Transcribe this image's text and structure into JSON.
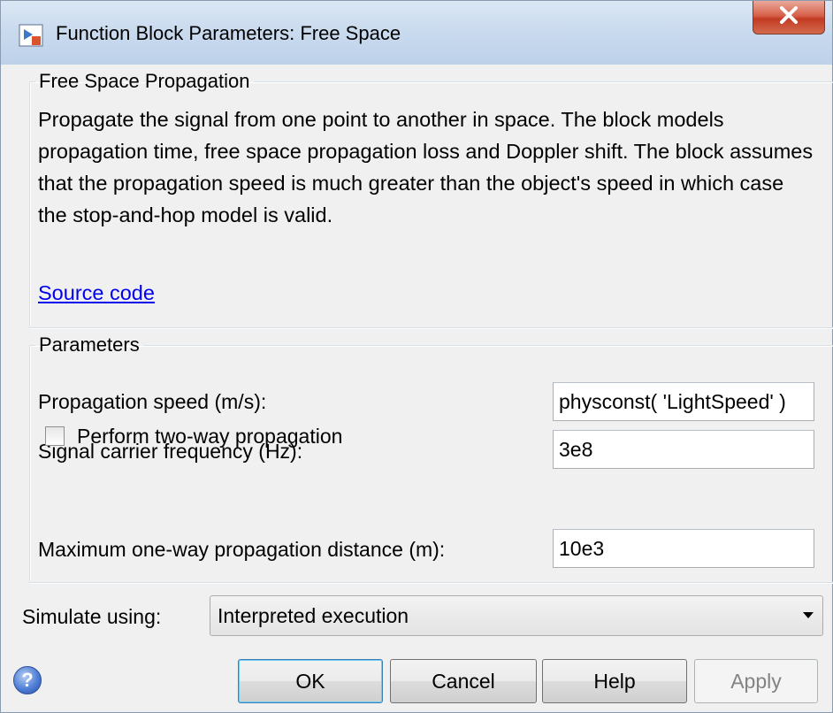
{
  "window": {
    "title": "Function Block Parameters: Free Space",
    "close_glyph": "X"
  },
  "description_group": {
    "legend": "Free Space Propagation",
    "text": "Propagate the signal from one point to another in space. The block models propagation time, free space propagation loss and Doppler shift. The block assumes that the propagation speed is much greater than the object's speed in which case the stop-and-hop model is valid.",
    "link": "Source code"
  },
  "parameters_group": {
    "legend": "Parameters",
    "propagation_speed": {
      "label": "Propagation speed (m/s):",
      "value": "physconst( 'LightSpeed' )"
    },
    "carrier_frequency": {
      "label": "Signal carrier frequency (Hz):",
      "value": "3e8"
    },
    "two_way": {
      "label": "Perform two-way propagation",
      "checked": false
    },
    "max_distance": {
      "label": "Maximum one-way propagation distance (m):",
      "value": "10e3"
    }
  },
  "simulate": {
    "label": "Simulate using:",
    "selected": "Interpreted execution"
  },
  "buttons": {
    "help_icon": "?",
    "ok": "OK",
    "cancel": "Cancel",
    "help": "Help",
    "apply": "Apply"
  },
  "colors": {
    "link": "#0000ee",
    "close_button": "#c23b22",
    "disabled_text": "#838383"
  }
}
